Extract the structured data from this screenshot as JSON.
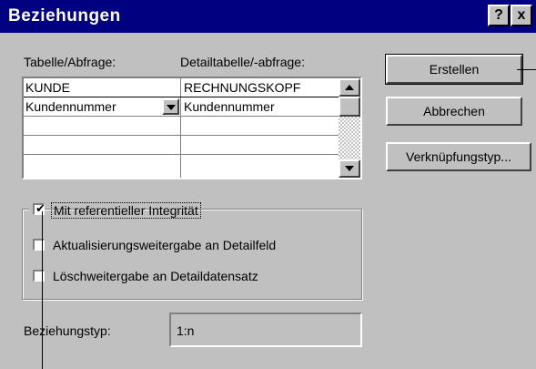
{
  "dialog": {
    "title": "Beziehungen",
    "help_button": "?",
    "close_button": "x"
  },
  "table_labels": {
    "left": "Tabelle/Abfrage:",
    "right": "Detailtabelle/-abfrage:"
  },
  "grid": {
    "rows": [
      {
        "left": "KUNDE",
        "right": "RECHNUNGSKOPF"
      },
      {
        "left": "Kundennummer",
        "right": "Kundennummer"
      },
      {
        "left": "",
        "right": ""
      },
      {
        "left": "",
        "right": ""
      }
    ]
  },
  "buttons": {
    "create": "Erstellen",
    "cancel": "Abbrechen",
    "join_type": "Verknüpfungstyp..."
  },
  "options": {
    "referential": {
      "label": "Mit referentieller Integrität",
      "checked": true
    },
    "cascade_update": {
      "label": "Aktualisierungsweitergabe an Detailfeld",
      "checked": false
    },
    "cascade_delete": {
      "label": "Löschweitergabe an Detaildatensatz",
      "checked": false
    }
  },
  "relation_type": {
    "label": "Beziehungstyp:",
    "value": "1:n"
  }
}
